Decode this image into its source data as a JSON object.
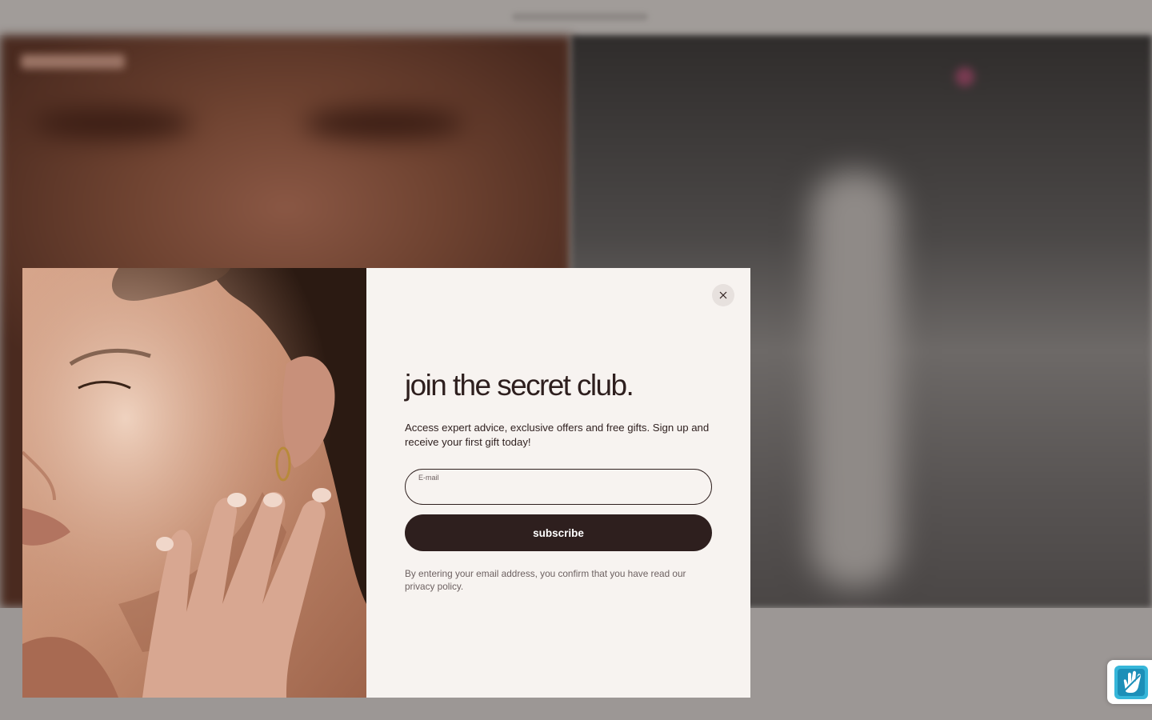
{
  "modal": {
    "headline": "join the secret club.",
    "description": "Access expert advice, exclusive offers and free gifts. Sign up and receive your first gift today!",
    "email": {
      "label": "E-mail",
      "value": "",
      "placeholder": ""
    },
    "subscribe_label": "subscribe",
    "disclaimer": "By entering your email address, you confirm that you have read our privacy policy.",
    "close_icon": "close-icon"
  },
  "colors": {
    "primary": "#2e1f1e",
    "panel_background": "#f7f3f0",
    "overlay": "#9a9593"
  },
  "widget": {
    "icon": "hand-icon"
  }
}
